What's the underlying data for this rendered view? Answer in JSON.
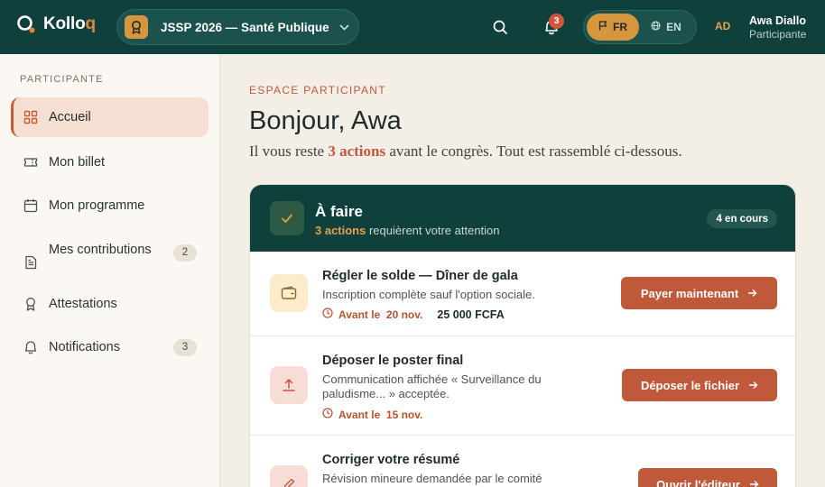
{
  "header": {
    "logo_text": "Kollo",
    "logo_accent": "q",
    "event_name": "JSSP 2026 — Santé Publique",
    "notification_count": "3",
    "languages": [
      {
        "code": "FR",
        "active": true
      },
      {
        "code": "EN",
        "active": false
      }
    ],
    "user_initials": "AD",
    "user_name": "Awa Diallo",
    "user_role": "Participante"
  },
  "sidebar": {
    "heading": "PARTICIPANTE",
    "items": [
      {
        "label": "Accueil",
        "icon": "grid-icon",
        "active": true
      },
      {
        "label": "Mon billet",
        "icon": "ticket-icon"
      },
      {
        "label": "Mon programme",
        "icon": "calendar-icon"
      },
      {
        "label": "Mes contributions",
        "icon": "document-icon",
        "count": "2"
      },
      {
        "label": "Attestations",
        "icon": "award-icon"
      },
      {
        "label": "Notifications",
        "icon": "bell-icon",
        "count": "3"
      }
    ]
  },
  "main": {
    "eyebrow": "ESPACE PARTICIPANT",
    "greeting": "Bonjour, Awa",
    "subtitle_before": "Il vous reste ",
    "subtitle_highlight": "3 actions",
    "subtitle_after": " avant le congrès. Tout est rassemblé ci-dessous."
  },
  "todo": {
    "title": "À faire",
    "sub_highlight": "3 actions",
    "sub_rest": " requièrent votre attention",
    "pill": "4 en cours",
    "tasks": [
      {
        "title": "Régler le solde — Dîner de gala",
        "desc": "Inscription complète sauf l'option sociale.",
        "due": "Avant le  20 nov.",
        "amount": "25 000 FCFA",
        "button": "Payer maintenant",
        "icon": "wallet-icon"
      },
      {
        "title": "Déposer le poster final",
        "desc": "Communication affichée « Surveillance du paludisme... » acceptée.",
        "due": "Avant le  15 nov.",
        "button": "Déposer le fichier",
        "icon": "upload-icon"
      },
      {
        "title": "Corriger votre résumé",
        "desc": "Révision mineure demandée par le comité",
        "button": "Ouvrir l'éditeur",
        "icon": "pencil-icon"
      }
    ]
  },
  "colors": {
    "header_bg": "#10403c",
    "accent": "#c0583a",
    "gold": "#d6963e",
    "page_bg": "#f4efe6"
  }
}
